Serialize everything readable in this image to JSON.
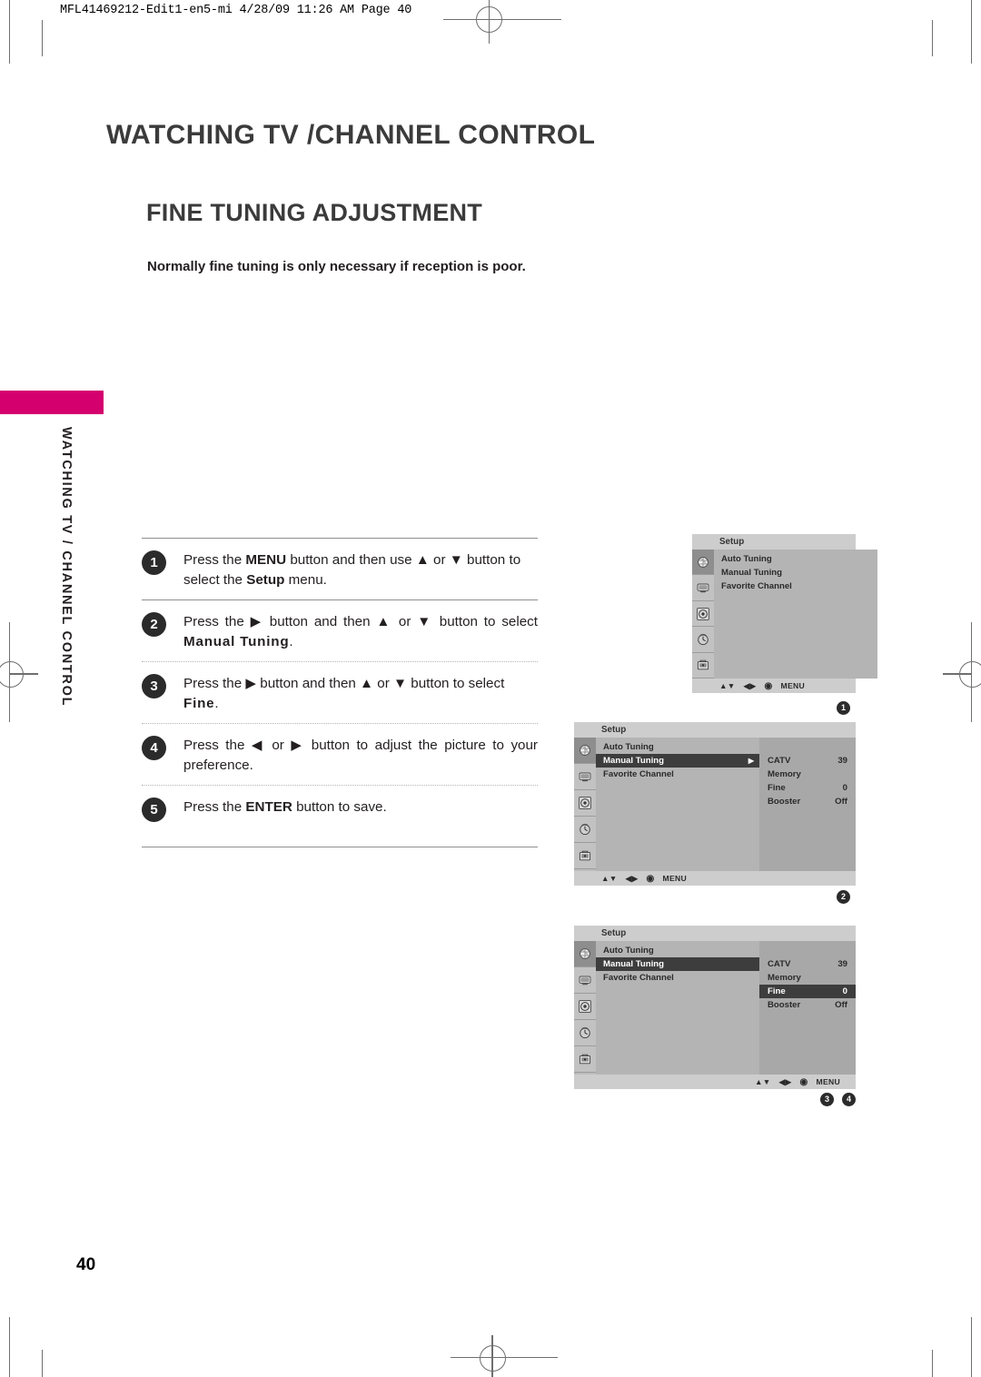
{
  "print_slug": "MFL41469212-Edit1-en5-mi  4/28/09 11:26 AM  Page 40",
  "chapter_title": "WATCHING TV /CHANNEL CONTROL",
  "section_title": "FINE TUNING ADJUSTMENT",
  "intro_note": "Normally fine tuning is only necessary if reception is poor.",
  "running_head": "WATCHING TV / CHANNEL CONTROL",
  "folio": "40",
  "accent_color": "#d4006e",
  "steps": [
    {
      "number": "1",
      "parts": [
        {
          "t": "Press the ",
          "b": false
        },
        {
          "t": "MENU",
          "b": true
        },
        {
          "t": " button and then use ▲ or ▼ button to select the ",
          "b": false
        },
        {
          "t": "Setup",
          "b": true
        },
        {
          "t": " menu.",
          "b": false
        }
      ]
    },
    {
      "number": "2",
      "parts": [
        {
          "t": "Press the ▶ button and then ▲ or ▼ button to select ",
          "b": false
        },
        {
          "t": "Manual Tuning",
          "b": true,
          "wide": true
        },
        {
          "t": ".",
          "b": false
        }
      ]
    },
    {
      "number": "3",
      "parts": [
        {
          "t": "Press the ▶ button and then ▲ or ▼ button to select ",
          "b": false
        },
        {
          "t": "Fine",
          "b": true,
          "wide": true
        },
        {
          "t": ".",
          "b": false
        }
      ]
    },
    {
      "number": "4",
      "parts": [
        {
          "t": "Press the ◀ or ▶ button to adjust the picture to your preference.",
          "b": false
        }
      ]
    },
    {
      "number": "5",
      "parts": [
        {
          "t": "Press the ",
          "b": false
        },
        {
          "t": "ENTER",
          "b": true
        },
        {
          "t": " button to save.",
          "b": false
        }
      ]
    }
  ],
  "osd": {
    "title": "Setup",
    "icon_names": [
      "channel-icon",
      "picture-icon",
      "audio-icon",
      "time-icon",
      "lock-icon"
    ],
    "footer": {
      "updown": "▲▼",
      "leftright": "◀▶",
      "enter": "◉",
      "menu": "MENU"
    },
    "panels": [
      {
        "marker": "1",
        "menu_items": [
          {
            "label": "Auto Tuning",
            "highlighted": false,
            "caret": false
          },
          {
            "label": "Manual Tuning",
            "highlighted": false,
            "caret": false
          },
          {
            "label": "Favorite Channel",
            "highlighted": false,
            "caret": false
          }
        ],
        "settings": [],
        "footer_align": "left"
      },
      {
        "marker": "2",
        "menu_items": [
          {
            "label": "Auto Tuning",
            "highlighted": false,
            "caret": false
          },
          {
            "label": "Manual Tuning",
            "highlighted": true,
            "caret": true
          },
          {
            "label": "Favorite Channel",
            "highlighted": false,
            "caret": false
          }
        ],
        "settings": [
          {
            "label": "CATV",
            "value": "39",
            "highlighted": false
          },
          {
            "label": "Memory",
            "value": "",
            "highlighted": false
          },
          {
            "label": "Fine",
            "value": "0",
            "highlighted": false
          },
          {
            "label": "Booster",
            "value": "Off",
            "highlighted": false
          }
        ],
        "footer_align": "left"
      },
      {
        "marker": "3",
        "marker2": "4",
        "menu_items": [
          {
            "label": "Auto Tuning",
            "highlighted": false,
            "caret": false
          },
          {
            "label": "Manual Tuning",
            "highlighted": true,
            "caret": false
          },
          {
            "label": "Favorite Channel",
            "highlighted": false,
            "caret": false
          }
        ],
        "settings": [
          {
            "label": "CATV",
            "value": "39",
            "highlighted": false
          },
          {
            "label": "Memory",
            "value": "",
            "highlighted": false
          },
          {
            "label": "Fine",
            "value": "0",
            "highlighted": true
          },
          {
            "label": "Booster",
            "value": "Off",
            "highlighted": false
          }
        ],
        "footer_align": "right"
      }
    ]
  }
}
